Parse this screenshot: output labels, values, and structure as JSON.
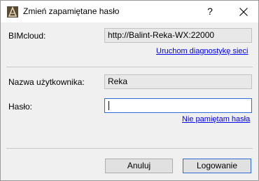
{
  "window": {
    "title": "Zmień zapamiętane hasło",
    "help_label": "?"
  },
  "bimcloud": {
    "label": "BIMcloud:",
    "value": "http://Balint-Reka-WX:22000",
    "diagnostics_link": "Uruchom diagnostykę sieci"
  },
  "username": {
    "label": "Nazwa użytkownika:",
    "value": "Reka"
  },
  "password": {
    "label": "Hasło:",
    "value": "",
    "forgot_link": "Nie pamiętam hasła"
  },
  "buttons": {
    "cancel": "Anuluj",
    "login": "Logowanie"
  },
  "colors": {
    "link": "#0000ee",
    "focus_border": "#2d6bd6",
    "dialog_bg": "#f0f0f0"
  },
  "icons": {
    "app": "archicad-icon",
    "close": "close-icon"
  }
}
